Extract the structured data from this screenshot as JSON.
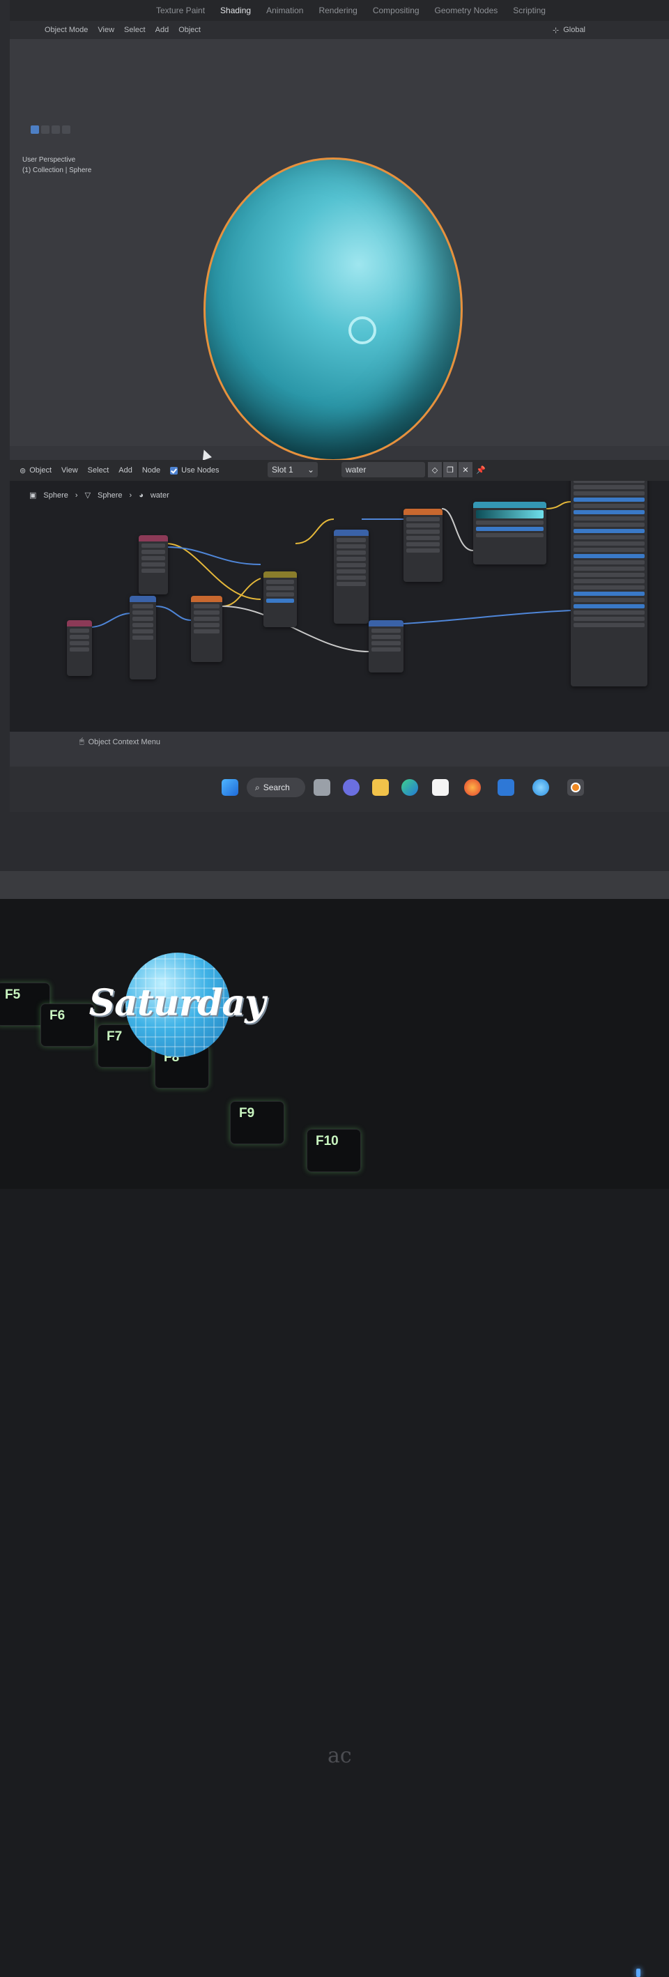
{
  "workspaces": [
    "Texture Paint",
    "Shading",
    "Animation",
    "Rendering",
    "Compositing",
    "Geometry Nodes",
    "Scripting"
  ],
  "viewport": {
    "mode": "Object Mode",
    "menus": [
      "View",
      "Select",
      "Add",
      "Object"
    ],
    "orientation": "Global",
    "info_line1": "User Perspective",
    "info_line2": "(1) Collection | Sphere"
  },
  "node_editor": {
    "type_label": "Object",
    "menus": [
      "View",
      "Select",
      "Add",
      "Node"
    ],
    "use_nodes_label": "Use Nodes",
    "use_nodes_checked": true,
    "slot": "Slot 1",
    "material": "water",
    "breadcrumb": [
      "Sphere",
      "Sphere",
      "water"
    ]
  },
  "status_bar": {
    "text": "Object Context Menu"
  },
  "taskbar": {
    "search_label": "Search"
  },
  "keyboard": {
    "keys": [
      "F5",
      "F6",
      "F7",
      "F8",
      "F9",
      "F10"
    ]
  },
  "sticker": {
    "text": "Saturday"
  },
  "laptop_brand": "ac",
  "colors": {
    "selection_outline": "#e7913d",
    "planet": "#55c2d1",
    "key_glow": "#6edc6e",
    "accent": "#4d82d1"
  }
}
